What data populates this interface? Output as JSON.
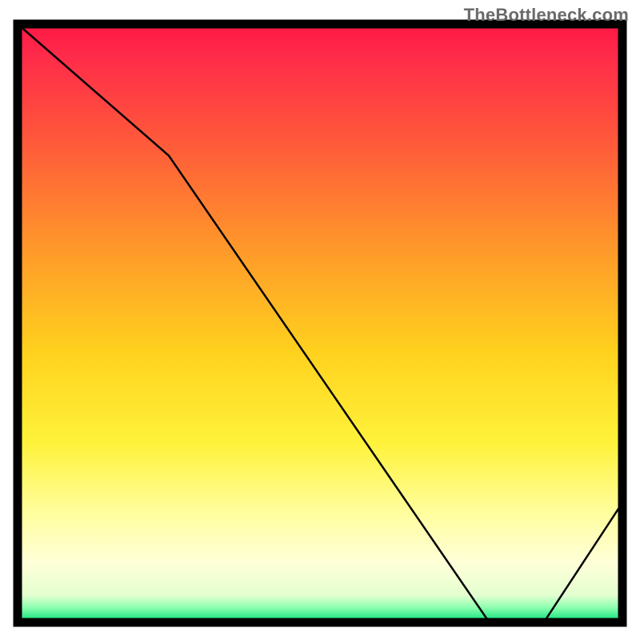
{
  "watermark": "TheBottleneck.com",
  "chart_data": {
    "type": "line",
    "title": "",
    "xlabel": "",
    "ylabel": "",
    "xlim": [
      0,
      100
    ],
    "ylim": [
      0,
      100
    ],
    "x": [
      0,
      25,
      78,
      87,
      100
    ],
    "values": [
      100,
      78,
      0,
      0,
      20
    ],
    "marker_region": {
      "x_start": 78,
      "x_end": 87,
      "y": 0
    },
    "gradient_stops": [
      {
        "offset": 0.0,
        "color": "#ff1744"
      },
      {
        "offset": 0.05,
        "color": "#ff2a4a"
      },
      {
        "offset": 0.2,
        "color": "#ff5a3a"
      },
      {
        "offset": 0.4,
        "color": "#ffa128"
      },
      {
        "offset": 0.55,
        "color": "#ffd21e"
      },
      {
        "offset": 0.7,
        "color": "#fff23a"
      },
      {
        "offset": 0.82,
        "color": "#fffea0"
      },
      {
        "offset": 0.9,
        "color": "#ffffd8"
      },
      {
        "offset": 0.955,
        "color": "#e3ffd0"
      },
      {
        "offset": 0.975,
        "color": "#8dffb0"
      },
      {
        "offset": 1.0,
        "color": "#00dd77"
      }
    ],
    "axis_color": "#000000",
    "line_color": "#000000",
    "line_width": 2.5
  }
}
